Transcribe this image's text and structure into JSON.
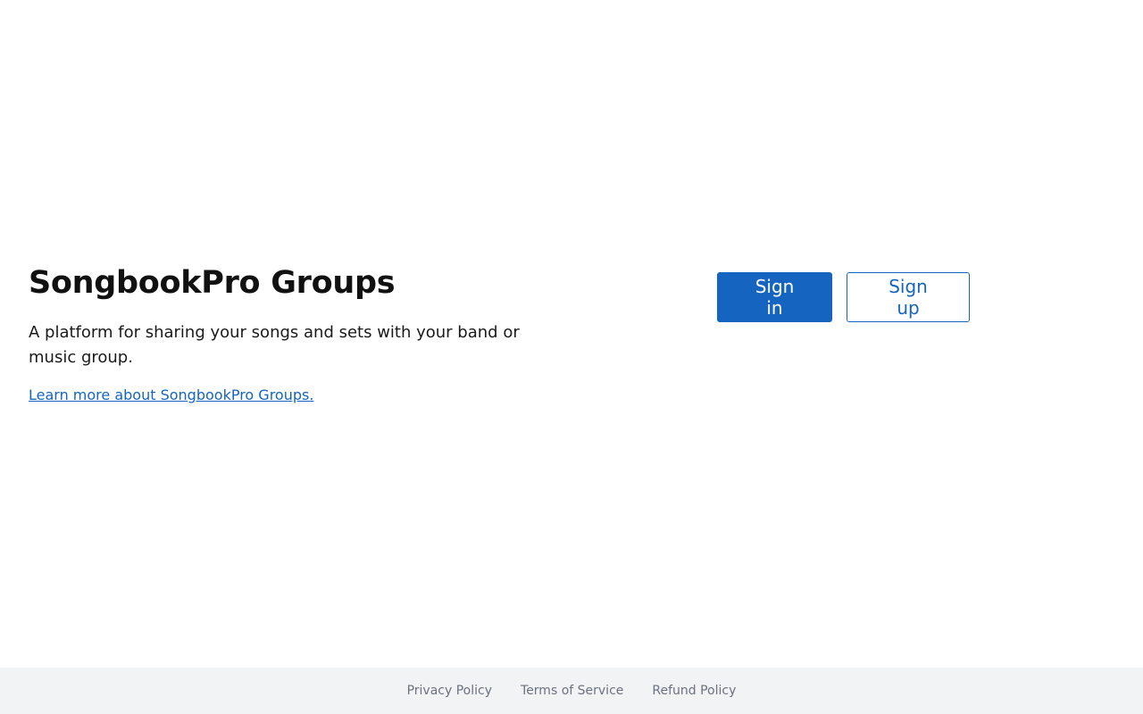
{
  "hero": {
    "title": "SongbookPro Groups",
    "description": "A platform for sharing your songs and sets with your band or music group.",
    "learn_more_link": "Learn more about SongbookPro Groups."
  },
  "auth": {
    "sign_in_label": "Sign in",
    "sign_up_label": "Sign up"
  },
  "footer": {
    "links": [
      "Privacy Policy",
      "Terms of Service",
      "Refund Policy"
    ]
  },
  "colors": {
    "accent": "#1565c0",
    "footer_background": "#f2f3f5",
    "footer_text": "#6b7280"
  }
}
